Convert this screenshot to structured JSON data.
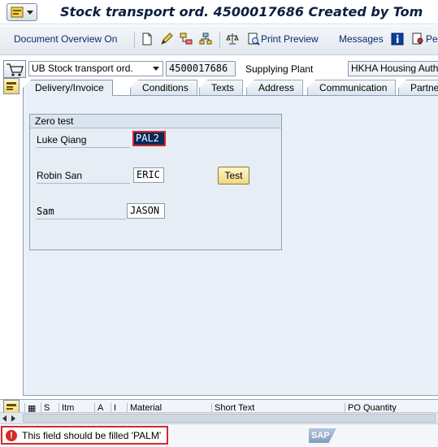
{
  "window": {
    "title": "Stock transport ord. 4500017686 Created by Tom"
  },
  "toolbar": {
    "document_overview": "Document Overview On",
    "print_preview": "Print Preview",
    "messages": "Messages",
    "personal_setting_partial": "Pe"
  },
  "header": {
    "doc_type": "UB Stock transport ord.",
    "doc_number": "4500017686",
    "supplying_plant_label": "Supplying Plant",
    "supplying_plant_value": "HKHA Housing Auth"
  },
  "tabs": [
    {
      "label": "Delivery/Invoice"
    },
    {
      "label": "Conditions"
    },
    {
      "label": "Texts"
    },
    {
      "label": "Address"
    },
    {
      "label": "Communication"
    },
    {
      "label": "Partner"
    }
  ],
  "group": {
    "title": "Zero test",
    "fields": [
      {
        "label": "Luke Qiang",
        "value": "PAL2"
      },
      {
        "label": "Robin San",
        "value": "ERIC"
      },
      {
        "label": "Sam",
        "value": "JASON"
      }
    ],
    "test_button": "Test"
  },
  "table": {
    "columns": [
      "S",
      "Itm",
      "A",
      "I",
      "Material",
      "Short Text",
      "PO Quantity"
    ]
  },
  "status": {
    "message": "This field should be filled 'PALM'",
    "logo": "SAP"
  },
  "colors": {
    "error": "#d42a2a",
    "panel": "#e9f0f7",
    "title_text": "#0b1f40"
  },
  "icons": {
    "menu": "sap-menu-icon",
    "error": "error-circle-icon",
    "info": "info-icon"
  }
}
